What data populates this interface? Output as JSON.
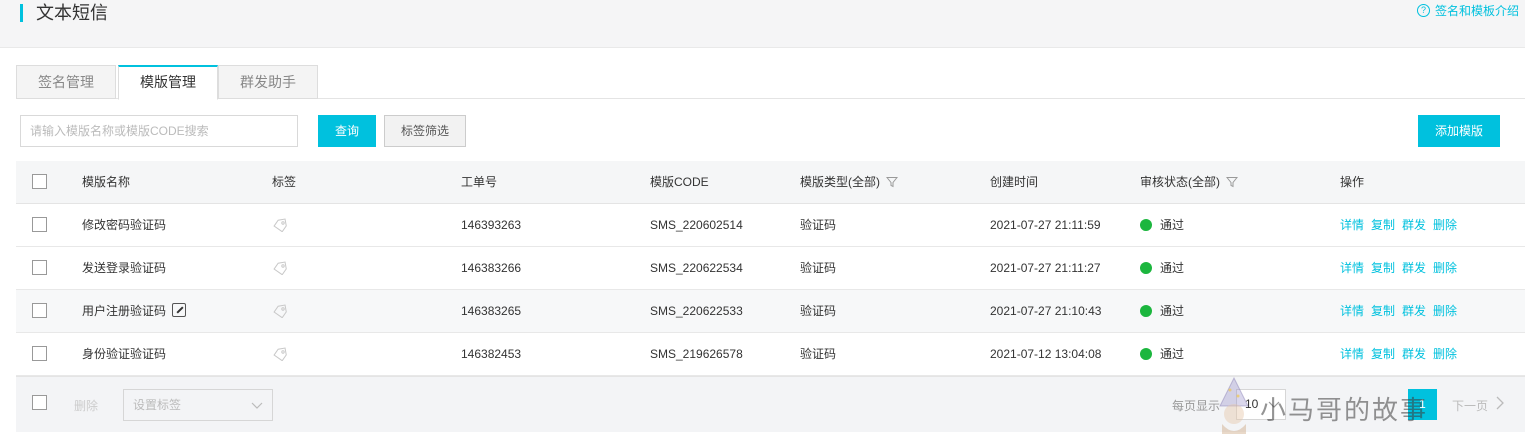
{
  "header": {
    "title": "文本短信",
    "help_link": "签名和模板介绍",
    "help_icon": "question-circle-icon",
    "accent": "#00c1de"
  },
  "tabs": [
    {
      "label": "签名管理",
      "active": false
    },
    {
      "label": "模版管理",
      "active": true
    },
    {
      "label": "群发助手",
      "active": false
    }
  ],
  "toolbar": {
    "search_placeholder": "请输入模版名称或模版CODE搜索",
    "search_value": "",
    "query_label": "查询",
    "tag_filter_label": "标签筛选",
    "add_label": "添加模版"
  },
  "table": {
    "columns": [
      "模版名称",
      "标签",
      "工单号",
      "模版CODE",
      "模版类型(全部)",
      "创建时间",
      "审核状态(全部)",
      "操作"
    ],
    "rows": [
      {
        "name": "修改密码验证码",
        "order": "146393263",
        "code": "SMS_220602514",
        "type": "验证码",
        "created": "2021-07-27 21:11:59",
        "status": "通过"
      },
      {
        "name": "发送登录验证码",
        "order": "146383266",
        "code": "SMS_220622534",
        "type": "验证码",
        "created": "2021-07-27 21:11:27",
        "status": "通过"
      },
      {
        "name": "用户注册验证码",
        "order": "146383265",
        "code": "SMS_220622533",
        "type": "验证码",
        "created": "2021-07-27 21:10:43",
        "status": "通过"
      },
      {
        "name": "身份验证验证码",
        "order": "146382453",
        "code": "SMS_219626578",
        "type": "验证码",
        "created": "2021-07-12 13:04:08",
        "status": "通过"
      }
    ],
    "ops": [
      "详情",
      "复制",
      "群发",
      "删除"
    ],
    "status_color": "#1cb63e"
  },
  "footer": {
    "delete_label": "删除",
    "tag_select_placeholder": "设置标签",
    "per_page_label": "每页显示",
    "page_size": "10",
    "current_page": "1",
    "next_label": "下一页"
  },
  "watermark": {
    "text": "小马哥的故事"
  }
}
